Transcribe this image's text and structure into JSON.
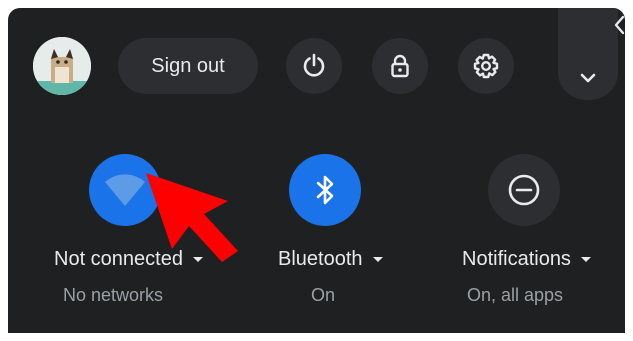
{
  "header": {
    "sign_out_label": "Sign out"
  },
  "icons": {
    "power": "power-icon",
    "lock": "lock-icon",
    "settings": "gear-icon",
    "expand": "chevron-down-icon",
    "collapse": "chevron-left-icon"
  },
  "tiles": [
    {
      "id": "network",
      "label": "Not connected",
      "sublabel": "No networks",
      "icon": "wifi-icon",
      "active": true
    },
    {
      "id": "bluetooth",
      "label": "Bluetooth",
      "sublabel": "On",
      "icon": "bluetooth-icon",
      "active": true
    },
    {
      "id": "notifications",
      "label": "Notifications",
      "sublabel": "On, all apps",
      "icon": "do-not-disturb-icon",
      "active": false
    }
  ],
  "colors": {
    "panel_bg": "#1f2022",
    "button_bg": "#2d2e31",
    "accent": "#1a73e8",
    "text_primary": "#e8eaed",
    "text_secondary": "#9aa0a6",
    "cursor": "#ff0000"
  }
}
